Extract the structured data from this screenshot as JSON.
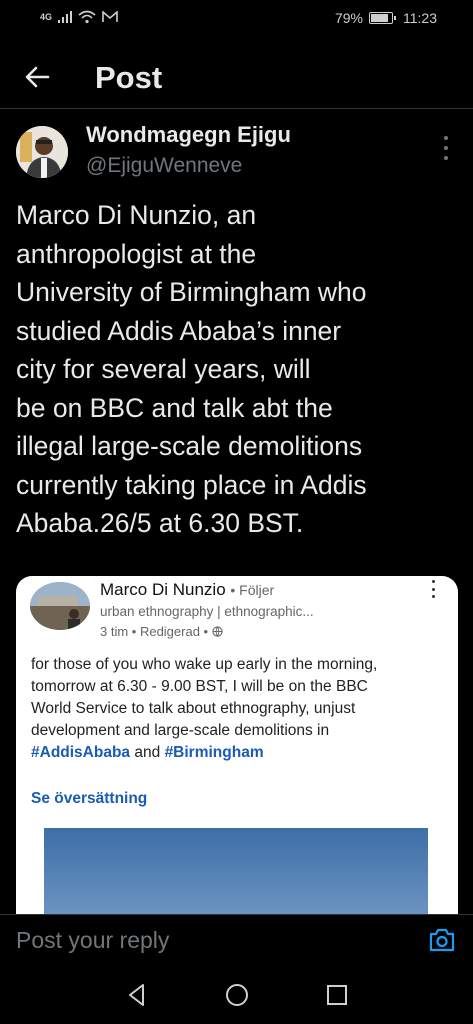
{
  "status_bar": {
    "network": "4G",
    "battery": "79%",
    "time": "11:23"
  },
  "header": {
    "title": "Post"
  },
  "author": {
    "name": "Wondmagegn Ejigu",
    "handle": "@EjiguWenneve"
  },
  "tweet": {
    "lines": [
      "Marco Di Nunzio, an",
      "anthropologist at the",
      "University of Birmingham who",
      "studied Addis Ababa’s inner",
      "city for several years, will",
      "be on BBC and talk abt the",
      "illegal large-scale demolitions",
      "currently taking place in Addis",
      "Ababa.26/5 at 6.30 BST."
    ]
  },
  "embedded": {
    "name": "Marco Di Nunzio",
    "follow": "• Följer",
    "subtitle": "urban ethnography | ethnographic...",
    "time": "3 tim • Redigerad •",
    "body_lines": [
      "for those of you who wake up early in the morning,",
      "tomorrow at 6.30 - 9.00 BST, I will be on the BBC",
      "World Service to talk about ethnography, unjust",
      "development and large-scale demolitions in"
    ],
    "tag1": "#AddisAbaba",
    "and": "and",
    "tag2": "#Birmingham",
    "translate": "Se översättning"
  },
  "reply": {
    "placeholder": "Post your reply"
  },
  "colors": {
    "background": "#000000",
    "text": "#e7e9ea",
    "muted": "#71767b",
    "link": "#1d9bf0"
  }
}
